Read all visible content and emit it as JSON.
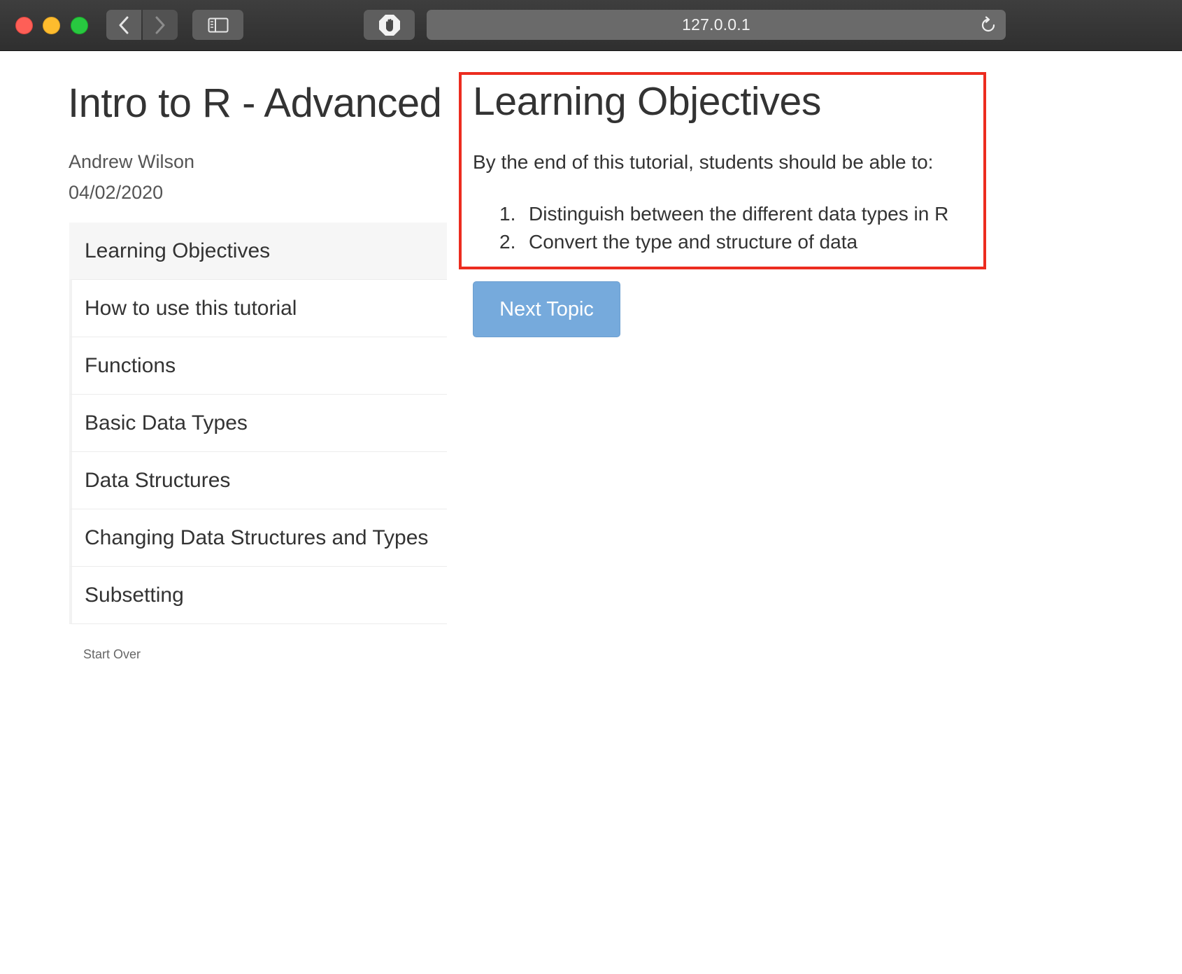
{
  "browser": {
    "url": "127.0.0.1"
  },
  "sidebar": {
    "title": "Intro to R - Advanced",
    "author": "Andrew Wilson",
    "date": "04/02/2020",
    "items": [
      {
        "label": "Learning Objectives",
        "active": true
      },
      {
        "label": "How to use this tutorial",
        "active": false
      },
      {
        "label": "Functions",
        "active": false
      },
      {
        "label": "Basic Data Types",
        "active": false
      },
      {
        "label": "Data Structures",
        "active": false
      },
      {
        "label": "Changing Data Structures and Types",
        "active": false
      },
      {
        "label": "Subsetting",
        "active": false
      }
    ],
    "start_over": "Start Over"
  },
  "main": {
    "title": "Learning Objectives",
    "intro": "By the end of this tutorial, students should be able to:",
    "objectives": [
      {
        "number": "1.",
        "text": "Distinguish between the different data types in R"
      },
      {
        "number": "2.",
        "text": "Convert the type and structure of data"
      }
    ],
    "next_button": "Next Topic"
  },
  "colors": {
    "highlight_border": "#ec2c1f",
    "next_button": "#76aadc",
    "active_item_bg": "#f6f6f6"
  },
  "icons": {
    "back": "chevron-left-icon",
    "forward": "chevron-right-icon",
    "sidebar": "sidebar-icon",
    "blocker": "hand-stop-icon",
    "reload": "reload-icon"
  }
}
